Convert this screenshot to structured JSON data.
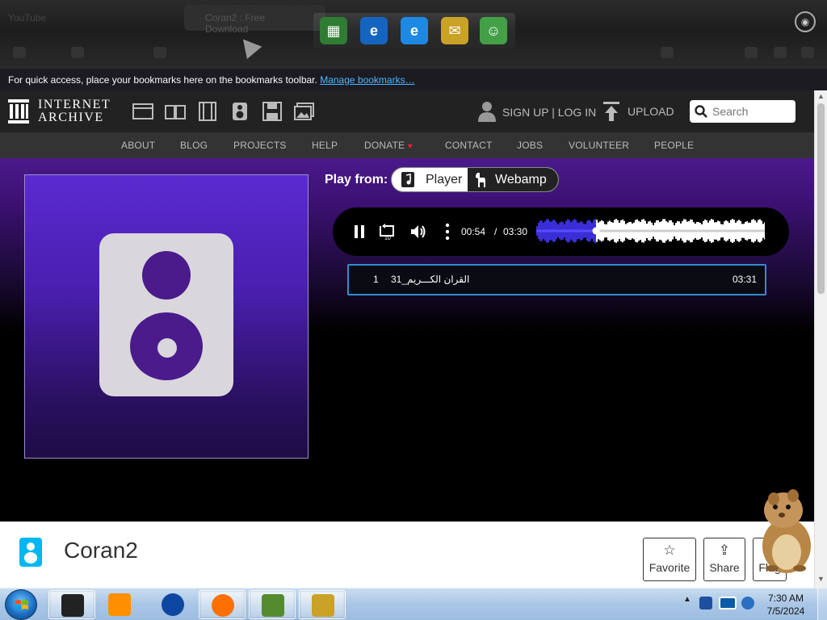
{
  "browser": {
    "tab_ghost_label": "YouTube",
    "tab2_ghost_label": "Coran2 : Free Download",
    "profile_glyph": "◉"
  },
  "dock": {
    "icons": [
      {
        "name": "3d-cube-app-icon",
        "glyph": "▦",
        "color": "#2e7d32"
      },
      {
        "name": "ie-update-icon",
        "glyph": "e",
        "color": "#1565c0"
      },
      {
        "name": "internet-explorer-icon",
        "glyph": "e",
        "color": "#1e88e5"
      },
      {
        "name": "mail-icon",
        "glyph": "✉",
        "color": "#c9a227"
      },
      {
        "name": "messenger-icon",
        "glyph": "☺",
        "color": "#43a047"
      }
    ]
  },
  "bookmarks": {
    "message": "For quick access, place your bookmarks here on the bookmarks toolbar.",
    "manage_link": "Manage bookmarks…"
  },
  "header": {
    "logo_line1": "INTERNET",
    "logo_line2": "ARCHIVE",
    "sign_up": "SIGN UP",
    "separator": "|",
    "log_in": "LOG IN",
    "upload": "UPLOAD",
    "search_placeholder": "Search"
  },
  "subnav": {
    "items": [
      "ABOUT",
      "BLOG",
      "PROJECTS",
      "HELP",
      "DONATE",
      "CONTACT",
      "JOBS",
      "VOLUNTEER",
      "PEOPLE"
    ],
    "donate_heart": "♥"
  },
  "player": {
    "play_from_label": "Play from:",
    "player_option": "Player",
    "webamp_option": "Webamp",
    "current_time": "00:54",
    "time_separator": "/",
    "total_time": "03:30",
    "progress": 0.26,
    "skip_back_seconds": "10"
  },
  "playlist": {
    "tracks": [
      {
        "number": "1",
        "title": "القران الكـــريم_31",
        "duration": "03:31"
      }
    ]
  },
  "item": {
    "title": "Coran2",
    "actions": [
      {
        "label": "Favorite",
        "glyph": "☆"
      },
      {
        "label": "Share",
        "glyph": "⇪"
      },
      {
        "label": "Flag",
        "glyph": "⚑"
      }
    ]
  },
  "taskbar": {
    "clock_time": "7:30 AM",
    "clock_date": "7/5/2024",
    "tray_arrow": "▲",
    "apps": [
      {
        "name": "taskbar-app-desktop",
        "color": "#222"
      },
      {
        "name": "taskbar-app-media-player",
        "color": "#ff8f00"
      },
      {
        "name": "taskbar-app-globe",
        "color": "#0d47a1"
      },
      {
        "name": "taskbar-app-firefox",
        "color": "#ff6f00"
      },
      {
        "name": "taskbar-app-box-game",
        "color": "#558b2f"
      },
      {
        "name": "taskbar-app-mail",
        "color": "#c9a227"
      }
    ]
  },
  "colors": {
    "accent_purple": "#4b1a8b",
    "playlist_border": "#2e8fd1",
    "link_blue": "#4cb8ff",
    "donate_red": "#e62235",
    "ia_dark": "#222222"
  }
}
